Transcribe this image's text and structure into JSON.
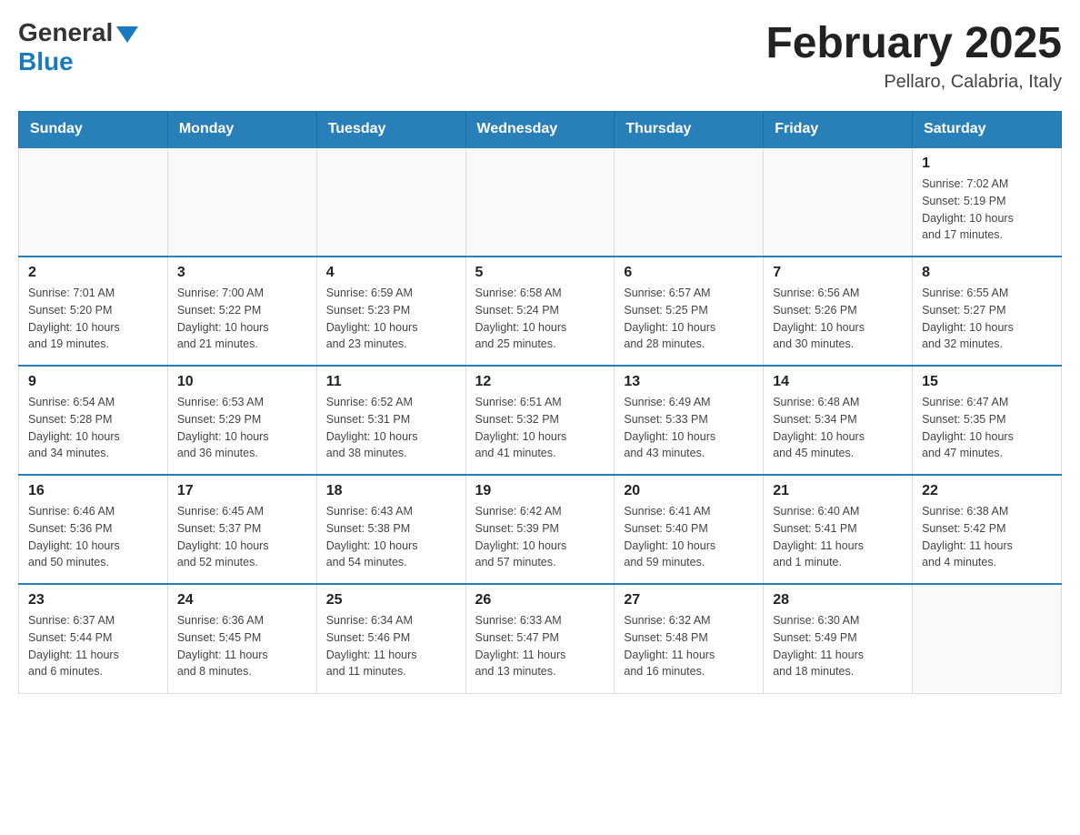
{
  "header": {
    "logo_general": "General",
    "logo_blue": "Blue",
    "month_title": "February 2025",
    "location": "Pellaro, Calabria, Italy"
  },
  "days_of_week": [
    "Sunday",
    "Monday",
    "Tuesday",
    "Wednesday",
    "Thursday",
    "Friday",
    "Saturday"
  ],
  "weeks": [
    [
      {
        "day": "",
        "info": ""
      },
      {
        "day": "",
        "info": ""
      },
      {
        "day": "",
        "info": ""
      },
      {
        "day": "",
        "info": ""
      },
      {
        "day": "",
        "info": ""
      },
      {
        "day": "",
        "info": ""
      },
      {
        "day": "1",
        "info": "Sunrise: 7:02 AM\nSunset: 5:19 PM\nDaylight: 10 hours\nand 17 minutes."
      }
    ],
    [
      {
        "day": "2",
        "info": "Sunrise: 7:01 AM\nSunset: 5:20 PM\nDaylight: 10 hours\nand 19 minutes."
      },
      {
        "day": "3",
        "info": "Sunrise: 7:00 AM\nSunset: 5:22 PM\nDaylight: 10 hours\nand 21 minutes."
      },
      {
        "day": "4",
        "info": "Sunrise: 6:59 AM\nSunset: 5:23 PM\nDaylight: 10 hours\nand 23 minutes."
      },
      {
        "day": "5",
        "info": "Sunrise: 6:58 AM\nSunset: 5:24 PM\nDaylight: 10 hours\nand 25 minutes."
      },
      {
        "day": "6",
        "info": "Sunrise: 6:57 AM\nSunset: 5:25 PM\nDaylight: 10 hours\nand 28 minutes."
      },
      {
        "day": "7",
        "info": "Sunrise: 6:56 AM\nSunset: 5:26 PM\nDaylight: 10 hours\nand 30 minutes."
      },
      {
        "day": "8",
        "info": "Sunrise: 6:55 AM\nSunset: 5:27 PM\nDaylight: 10 hours\nand 32 minutes."
      }
    ],
    [
      {
        "day": "9",
        "info": "Sunrise: 6:54 AM\nSunset: 5:28 PM\nDaylight: 10 hours\nand 34 minutes."
      },
      {
        "day": "10",
        "info": "Sunrise: 6:53 AM\nSunset: 5:29 PM\nDaylight: 10 hours\nand 36 minutes."
      },
      {
        "day": "11",
        "info": "Sunrise: 6:52 AM\nSunset: 5:31 PM\nDaylight: 10 hours\nand 38 minutes."
      },
      {
        "day": "12",
        "info": "Sunrise: 6:51 AM\nSunset: 5:32 PM\nDaylight: 10 hours\nand 41 minutes."
      },
      {
        "day": "13",
        "info": "Sunrise: 6:49 AM\nSunset: 5:33 PM\nDaylight: 10 hours\nand 43 minutes."
      },
      {
        "day": "14",
        "info": "Sunrise: 6:48 AM\nSunset: 5:34 PM\nDaylight: 10 hours\nand 45 minutes."
      },
      {
        "day": "15",
        "info": "Sunrise: 6:47 AM\nSunset: 5:35 PM\nDaylight: 10 hours\nand 47 minutes."
      }
    ],
    [
      {
        "day": "16",
        "info": "Sunrise: 6:46 AM\nSunset: 5:36 PM\nDaylight: 10 hours\nand 50 minutes."
      },
      {
        "day": "17",
        "info": "Sunrise: 6:45 AM\nSunset: 5:37 PM\nDaylight: 10 hours\nand 52 minutes."
      },
      {
        "day": "18",
        "info": "Sunrise: 6:43 AM\nSunset: 5:38 PM\nDaylight: 10 hours\nand 54 minutes."
      },
      {
        "day": "19",
        "info": "Sunrise: 6:42 AM\nSunset: 5:39 PM\nDaylight: 10 hours\nand 57 minutes."
      },
      {
        "day": "20",
        "info": "Sunrise: 6:41 AM\nSunset: 5:40 PM\nDaylight: 10 hours\nand 59 minutes."
      },
      {
        "day": "21",
        "info": "Sunrise: 6:40 AM\nSunset: 5:41 PM\nDaylight: 11 hours\nand 1 minute."
      },
      {
        "day": "22",
        "info": "Sunrise: 6:38 AM\nSunset: 5:42 PM\nDaylight: 11 hours\nand 4 minutes."
      }
    ],
    [
      {
        "day": "23",
        "info": "Sunrise: 6:37 AM\nSunset: 5:44 PM\nDaylight: 11 hours\nand 6 minutes."
      },
      {
        "day": "24",
        "info": "Sunrise: 6:36 AM\nSunset: 5:45 PM\nDaylight: 11 hours\nand 8 minutes."
      },
      {
        "day": "25",
        "info": "Sunrise: 6:34 AM\nSunset: 5:46 PM\nDaylight: 11 hours\nand 11 minutes."
      },
      {
        "day": "26",
        "info": "Sunrise: 6:33 AM\nSunset: 5:47 PM\nDaylight: 11 hours\nand 13 minutes."
      },
      {
        "day": "27",
        "info": "Sunrise: 6:32 AM\nSunset: 5:48 PM\nDaylight: 11 hours\nand 16 minutes."
      },
      {
        "day": "28",
        "info": "Sunrise: 6:30 AM\nSunset: 5:49 PM\nDaylight: 11 hours\nand 18 minutes."
      },
      {
        "day": "",
        "info": ""
      }
    ]
  ]
}
